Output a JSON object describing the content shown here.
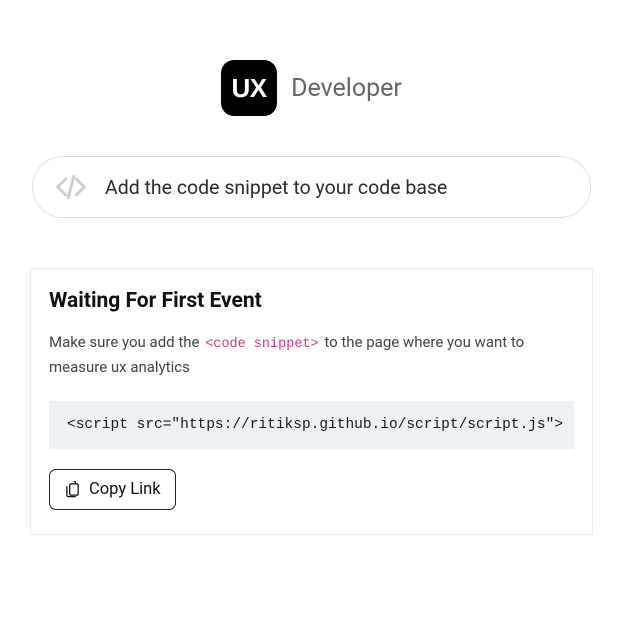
{
  "header": {
    "logo_text": "UX",
    "title": "Developer"
  },
  "pill": {
    "text": "Add the code snippet to your code base"
  },
  "card": {
    "title": "Waiting For First Event",
    "desc_before": "Make sure you add the ",
    "inline_code": "<code snippet>",
    "desc_after": " to the page where you want to measure ux analytics",
    "code_block": "<script src=\"https://ritiksp.github.io/script/script.js\">",
    "copy_label": "Copy Link"
  }
}
